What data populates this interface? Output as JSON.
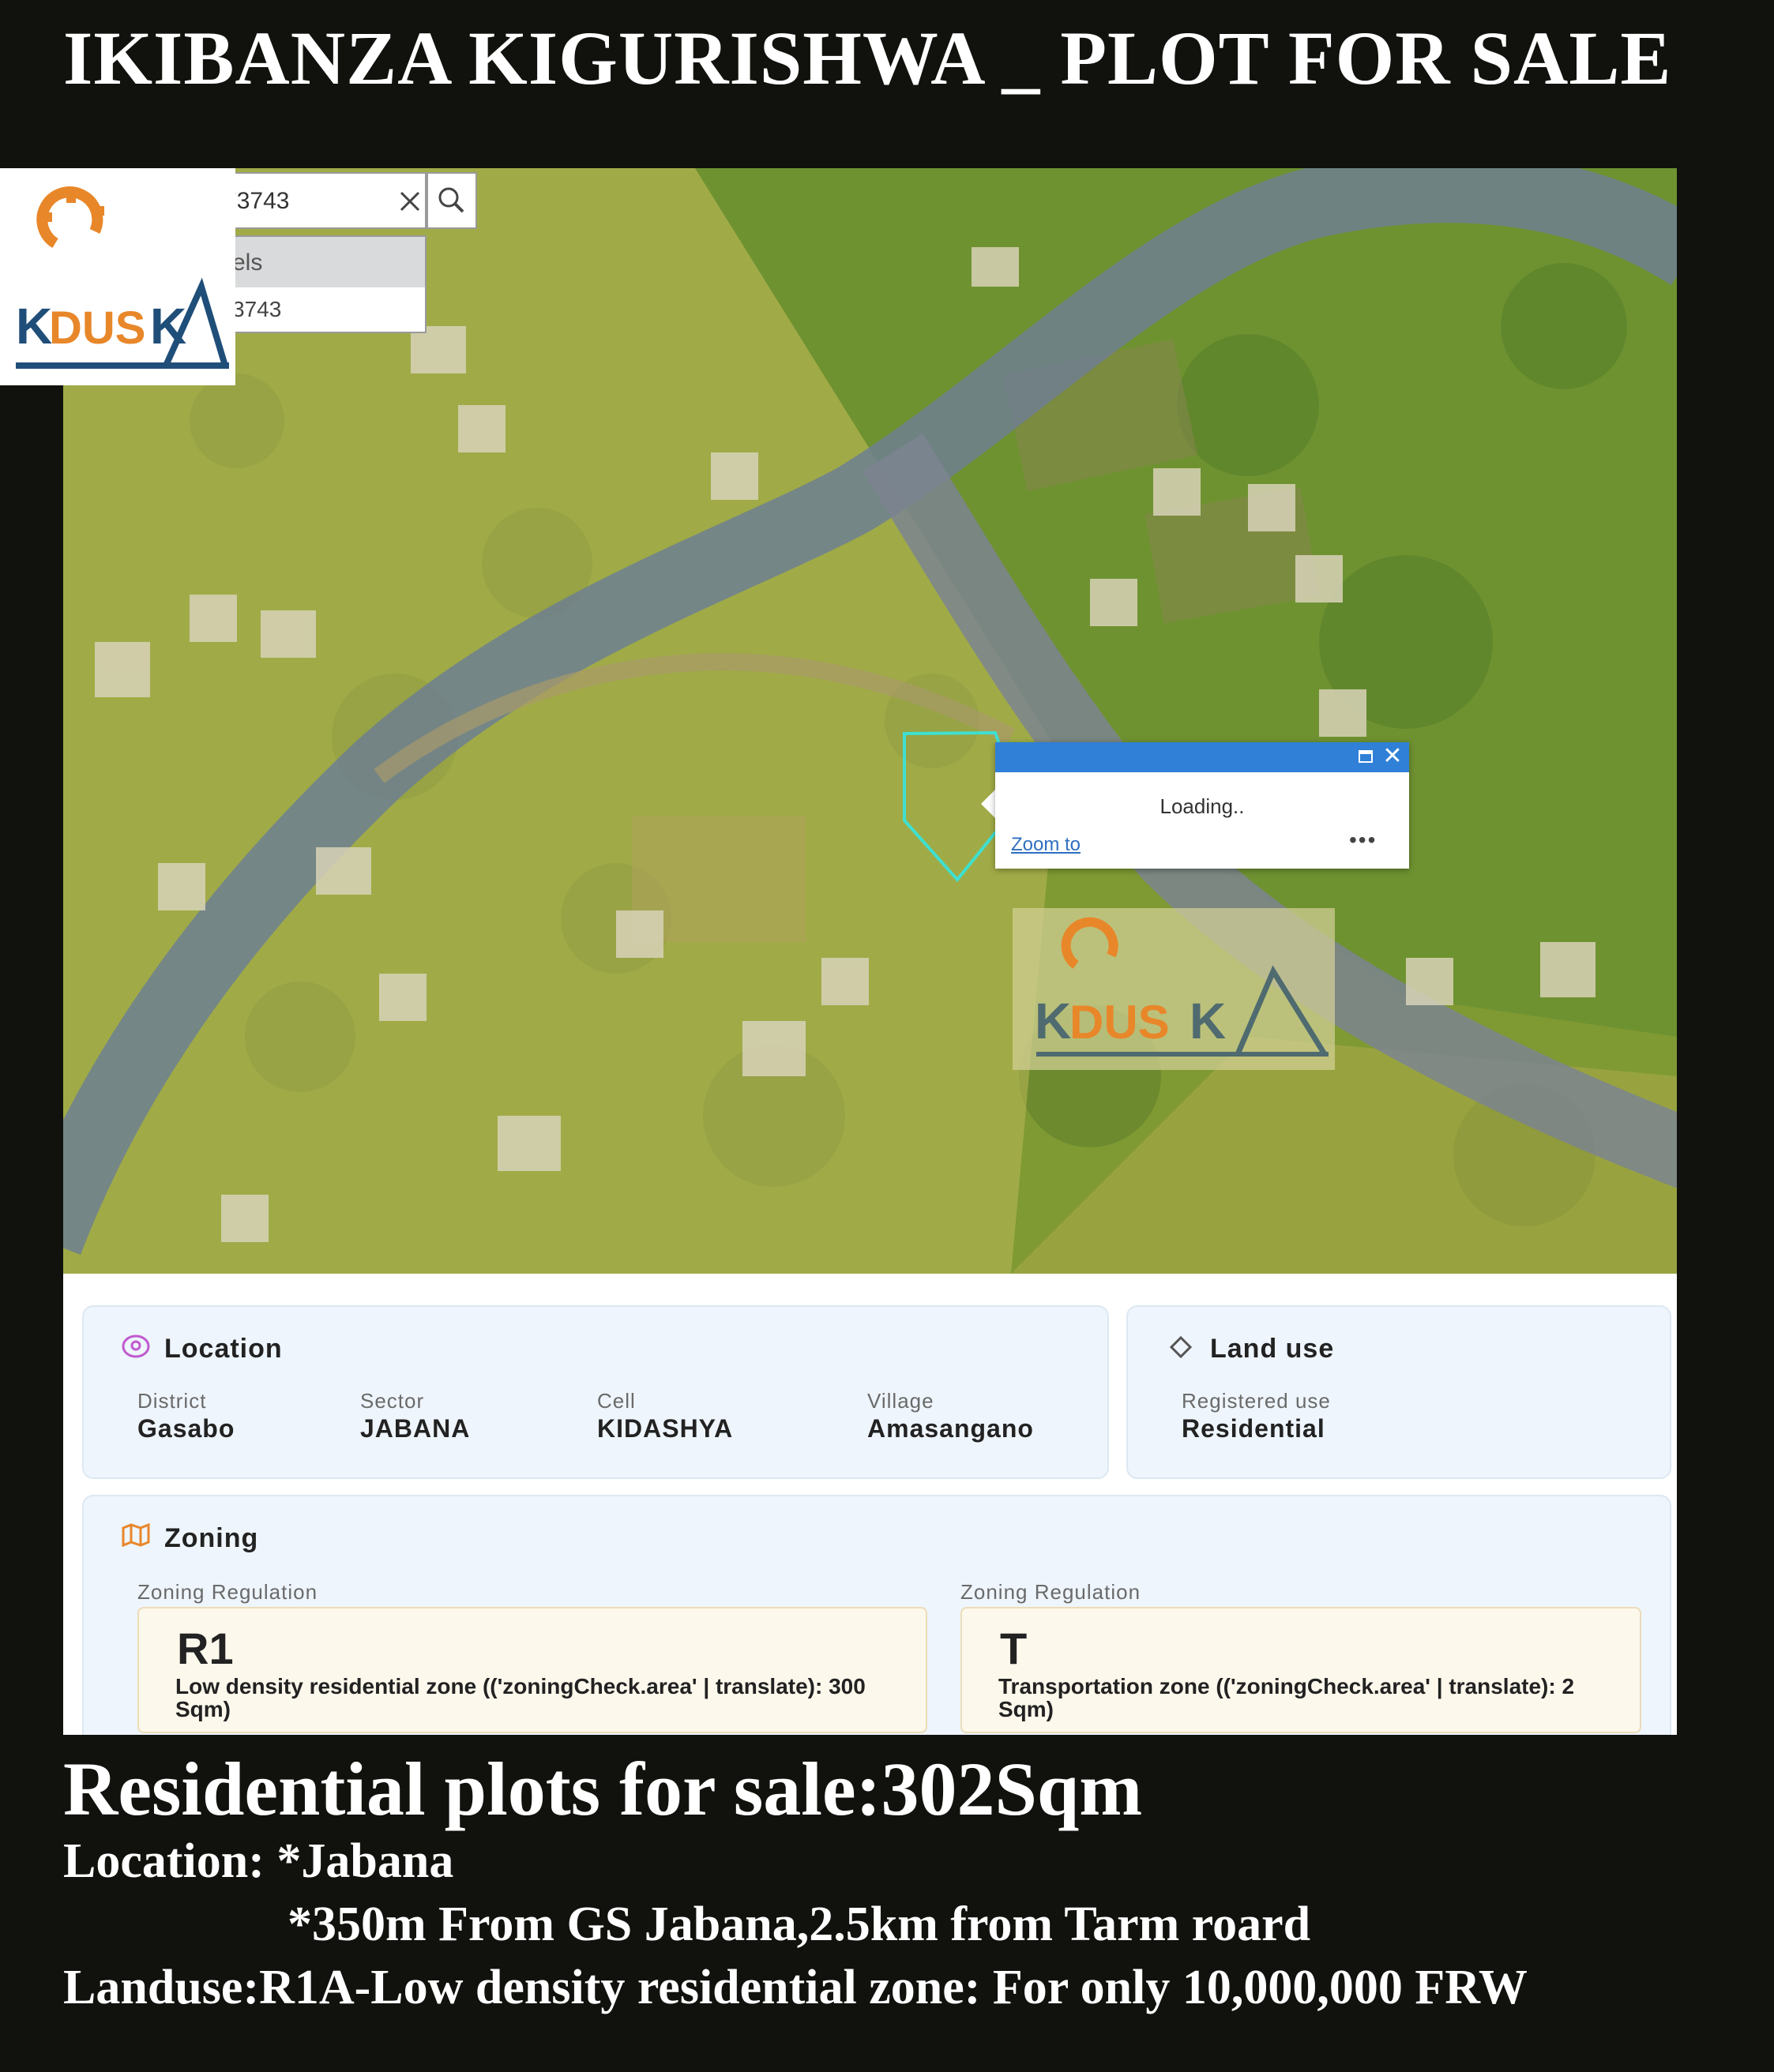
{
  "headline": "IKIBANZA KIGURISHWA _ PLOT FOR SALE",
  "colors": {
    "background": "#11110d",
    "map_land": "#8ea53a",
    "map_zone_overlay": "#b8b050",
    "road": "#6f7f92",
    "parcel_outline": "#3ee0d0",
    "popup_bar": "#2f80d6",
    "logo_orange": "#e8872a",
    "logo_navy": "#1f4e79"
  },
  "search": {
    "value": "'3743",
    "suggest_header": "els",
    "suggest_item": "3743"
  },
  "logo": {
    "text": "KDUSKA"
  },
  "popup": {
    "loading": "Loading..",
    "zoom_link": "Zoom to",
    "more": "•••"
  },
  "location": {
    "title": "Location",
    "district_label": "District",
    "district": "Gasabo",
    "sector_label": "Sector",
    "sector": "JABANA",
    "cell_label": "Cell",
    "cell": "KIDASHYA",
    "village_label": "Village",
    "village": "Amasangano"
  },
  "land_use": {
    "title": "Land use",
    "registered_label": "Registered use",
    "registered": "Residential"
  },
  "zoning": {
    "title": "Zoning",
    "items": [
      {
        "label": "Zoning Regulation",
        "code": "R1",
        "desc": "Low density residential zone (('zoningCheck.area' | translate): 300 Sqm)"
      },
      {
        "label": "Zoning Regulation",
        "code": "T",
        "desc": "Transportation zone (('zoningCheck.area' | translate): 2 Sqm)"
      }
    ]
  },
  "footer": {
    "title": "Residential plots for sale:302Sqm",
    "location": "Location: *Jabana",
    "distance": "*350m From GS Jabana,2.5km from Tarm roard",
    "landuse": "Landuse:R1A-Low density residential zone:  For only 10,000,000 FRW"
  }
}
